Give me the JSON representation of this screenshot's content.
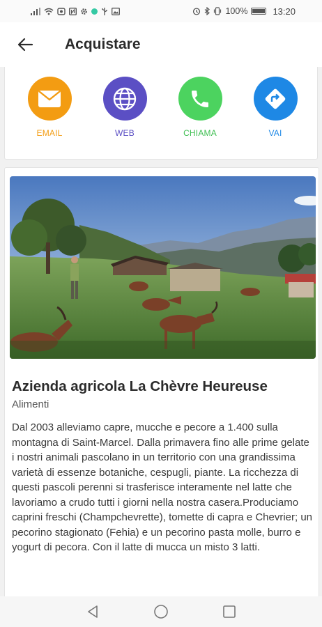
{
  "status_bar": {
    "battery": "100%",
    "time": "13:20"
  },
  "app_bar": {
    "title": "Acquistare",
    "back_icon": "arrow-left-icon"
  },
  "actions": [
    {
      "label": "EMAIL",
      "icon": "mail-icon",
      "color": "#f39c12",
      "label_color": "#f39c12"
    },
    {
      "label": "WEB",
      "icon": "globe-icon",
      "color": "#5b4fc4",
      "label_color": "#5b4fc4"
    },
    {
      "label": "CHIAMA",
      "icon": "phone-icon",
      "color": "#4cd35f",
      "label_color": "#3fbf52"
    },
    {
      "label": "VAI",
      "icon": "directions-icon",
      "color": "#1e88e5",
      "label_color": "#1e88e5"
    }
  ],
  "place": {
    "title": "Azienda agricola La Chèvre Heureuse",
    "category": "Alimenti",
    "description": "Dal 2003 alleviamo capre, mucche e pecore a 1.400 sulla montagna di Saint-Marcel. Dalla primavera fino alle prime gelate i nostri animali pascolano in un territorio con una grandissima varietà di essenze botaniche, cespugli, piante. La ricchezza di questi pascoli perenni si trasferisce interamente nel latte che lavoriamo a crudo tutti i giorni nella nostra casera.Produciamo caprini freschi (Champchevrette), tomette di capra e Chevrier; un pecorino stagionato (Fehia) e un pecorino pasta molle, burro e yogurt di pecora. Con il latte di mucca un misto 3 latti."
  },
  "nav_bar": {
    "back": "nav-back-icon",
    "home": "nav-home-icon",
    "recents": "nav-recents-icon"
  }
}
